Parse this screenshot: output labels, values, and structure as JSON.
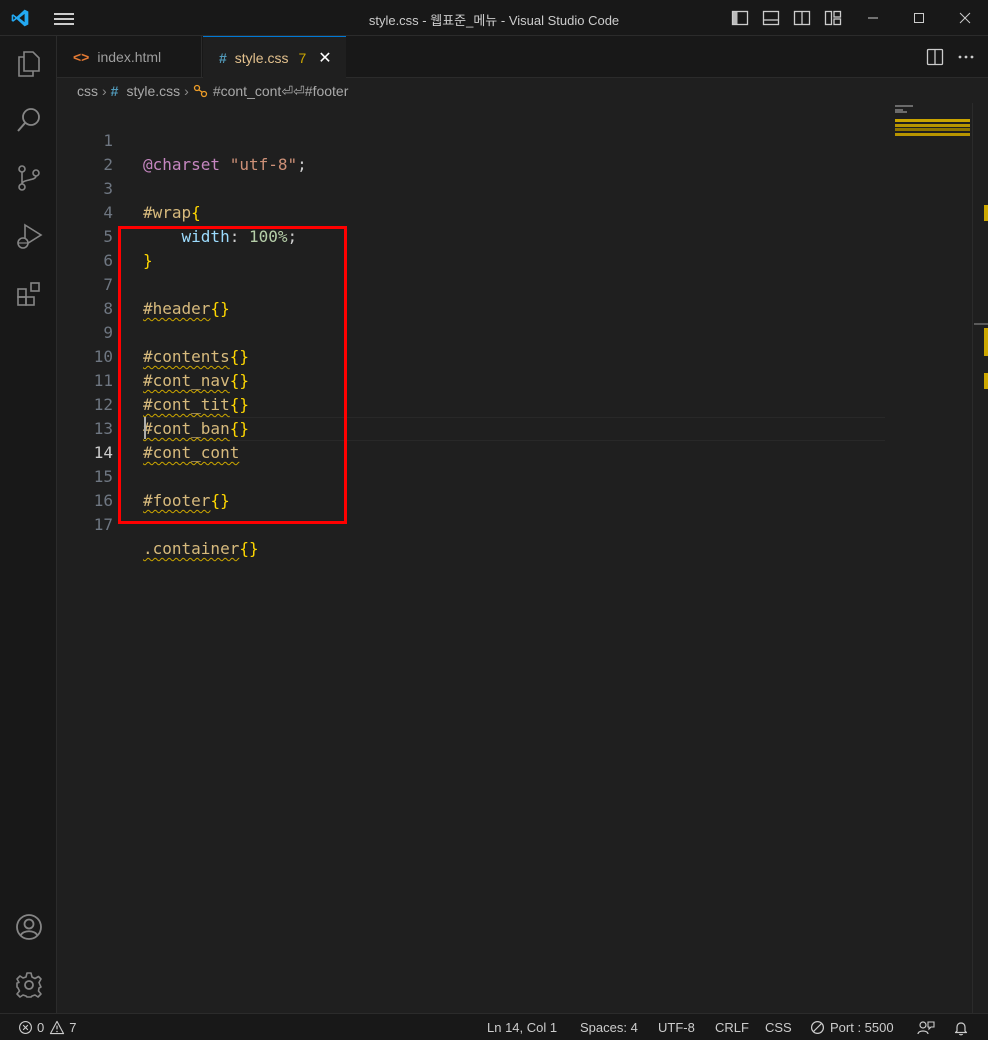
{
  "window": {
    "title": "style.css - 웹표준_메뉴 - Visual Studio Code"
  },
  "tabs": [
    {
      "label": "index.html",
      "icon": "<>",
      "icon_color": "#e37933"
    },
    {
      "label": "style.css",
      "icon": "#",
      "icon_color": "#519aba",
      "problems": "7",
      "close": "✕"
    }
  ],
  "breadcrumb": {
    "folder": "css",
    "file": "style.css",
    "symbol": "#cont_cont⏎⏎#footer"
  },
  "editor": {
    "current_line": 14,
    "lines": [
      {
        "n": "1"
      },
      {
        "n": "2"
      },
      {
        "n": "3"
      },
      {
        "n": "4"
      },
      {
        "n": "5"
      },
      {
        "n": "6"
      },
      {
        "n": "7"
      },
      {
        "n": "8"
      },
      {
        "n": "9"
      },
      {
        "n": "10"
      },
      {
        "n": "11"
      },
      {
        "n": "12"
      },
      {
        "n": "13"
      },
      {
        "n": "14"
      },
      {
        "n": "15"
      },
      {
        "n": "16"
      },
      {
        "n": "17"
      }
    ],
    "code": {
      "charset_kw": "@charset",
      "charset_val": "\"utf-8\"",
      "semicolon": ";",
      "wrap_sel": "#wrap",
      "open": "{",
      "close": "}",
      "empty": "{}",
      "width_prop": "width",
      "colon": ": ",
      "width_val": "100%",
      "header_sel": "#header",
      "contents_sel": "#contents",
      "cont_nav_sel": "#cont_nav",
      "cont_tit_sel": "#cont_tit",
      "cont_ban_sel": "#cont_ban",
      "cont_cont_sel": "#cont_cont",
      "footer_sel": "#footer",
      "container_sel": ".container"
    }
  },
  "status": {
    "errors": "0",
    "warnings": "7",
    "position": "Ln 14, Col 1",
    "spaces": "Spaces: 4",
    "encoding": "UTF-8",
    "eol": "CRLF",
    "language": "CSS",
    "port": "Port : 5500"
  },
  "colors": {
    "accent": "#0078d4",
    "warning": "#cca700",
    "highlight_box": "#ff0000"
  }
}
